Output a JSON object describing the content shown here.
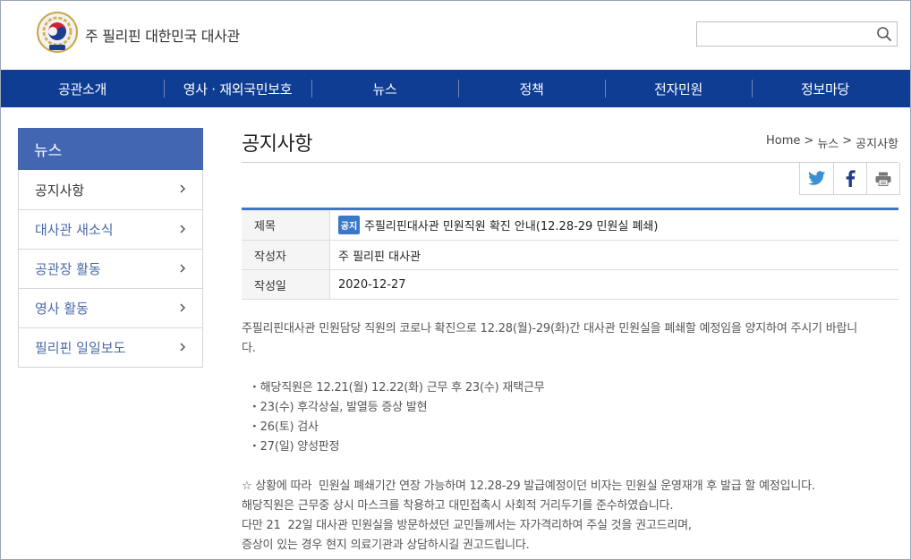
{
  "header": {
    "site_title": "주 필리핀 대한민국 대사관",
    "logo_icon": "korea-emblem-icon",
    "search": {
      "value": "",
      "placeholder": "",
      "icon": "search-icon"
    }
  },
  "nav": {
    "items": [
      {
        "label": "공관소개"
      },
      {
        "label": "영사 · 재외국민보호"
      },
      {
        "label": "뉴스"
      },
      {
        "label": "정책"
      },
      {
        "label": "전자민원"
      },
      {
        "label": "정보마당"
      }
    ],
    "color": "#0e3d93"
  },
  "sidebar": {
    "heading": "뉴스",
    "heading_color": "#4266b2",
    "items": [
      {
        "label": "공지사항",
        "active": true
      },
      {
        "label": "대사관 새소식"
      },
      {
        "label": "공관장 활동"
      },
      {
        "label": "영사 활동"
      },
      {
        "label": "필리핀 일일보도"
      }
    ]
  },
  "content": {
    "page_title": "공지사항",
    "breadcrumb": [
      "Home",
      ">",
      "뉴스",
      ">",
      "공지사항"
    ],
    "share_icons": [
      "twitter-icon",
      "facebook-icon",
      "print-icon"
    ],
    "post": {
      "rows": [
        {
          "label": "제목",
          "badge": "공지",
          "value": "주필리핀대사관 민원직원 확진 안내(12.28-29 민원실 폐쇄)"
        },
        {
          "label": "작성자",
          "value": "주 필리핀 대사관"
        },
        {
          "label": "작성일",
          "value": "2020-12-27"
        }
      ],
      "accent_color": "#3f74c6"
    },
    "body_lines": [
      "주필리핀대사관 민원담당 직원의 코로나 확진으로 12.28(월)-29(화)간 대사관 민원실을 폐쇄할 예정임을 양지하여 주시기 바랍니",
      "다.",
      "",
      "  ・해당직원은 12.21(월) 12.22(화) 근무 후 23(수) 재택근무",
      "  ・23(수) 후각상실, 발열등 증상 발현",
      "  ・26(토) 검사",
      "  ・27(일) 양성판정",
      "",
      "☆ 상황에 따라  민원실 폐쇄기간 연장 가능하며 12.28-29 발급예정이던 비자는 민원실 운영재개 후 발급 할 예정입니다.",
      "해당직원은 근무중 상시 마스크를 착용하고 대민접촉시 사회적 거리두기를 준수하였습니다.",
      "다만 21  22일 대사관 민원실을 방문하셨던 교민들께서는 자가격리하여 주실 것을 권고드리며,",
      "증상이 있는 경우 현지 의료기관과 상담하시길 권고드립니다."
    ]
  }
}
